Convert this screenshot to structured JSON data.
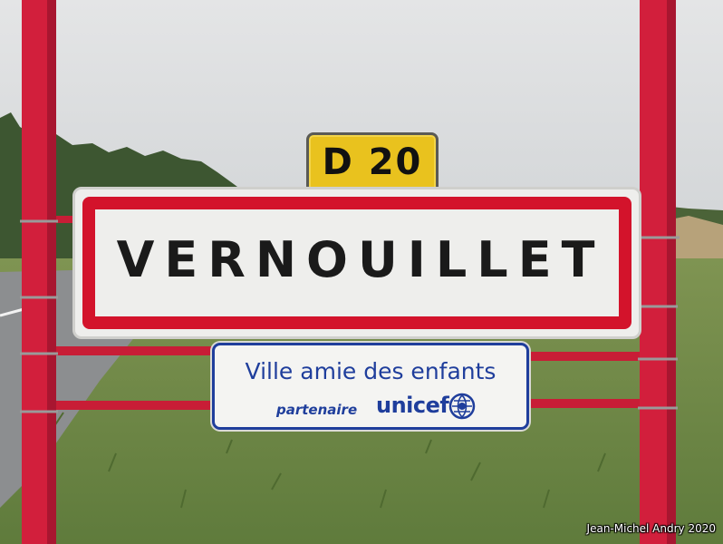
{
  "scene": {
    "description_colors": {
      "sky": "#dcdedf",
      "trees": "#3f5a34",
      "grass": "#6f8a45",
      "road": "#8a8c8e",
      "pole": "#d21f3c"
    }
  },
  "road_plate": {
    "text": "D 20",
    "background": "#e9c21e"
  },
  "town_sign": {
    "name": "VERNOUILLET",
    "border_color": "#d3132b"
  },
  "unicef_panel": {
    "title": "Ville amie des enfants",
    "partner_label": "partenaire",
    "brand": "unicef",
    "color": "#1f3e9c"
  },
  "credit": "Jean-Michel Andry 2020"
}
